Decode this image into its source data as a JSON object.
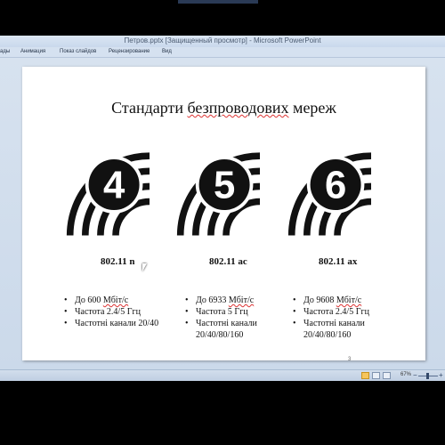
{
  "window": {
    "title": "Петров.pptx [Защищенный просмотр] - Microsoft PowerPoint"
  },
  "ribbon": {
    "tabs": [
      "ады",
      "Анимация",
      "Показ слайдов",
      "Рецензирование",
      "Вид"
    ]
  },
  "slide": {
    "title_pre": "Стандарти ",
    "title_underlined": "безпроводових",
    "title_post": " мереж",
    "number": "3",
    "columns": [
      {
        "icon_digit": "4",
        "icon_name": "wifi-4-icon",
        "standard": "802.11 n",
        "specs": [
          {
            "pre": "До 600 ",
            "u": "Мбіт/с",
            "post": ""
          },
          {
            "pre": "Частота 2.4/5 Ггц",
            "u": "",
            "post": ""
          },
          {
            "pre": "Частотні канали 20/40",
            "u": "",
            "post": ""
          }
        ]
      },
      {
        "icon_digit": "5",
        "icon_name": "wifi-5-icon",
        "standard": "802.11 ac",
        "specs": [
          {
            "pre": "До 6933 ",
            "u": "Мбіт/с",
            "post": ""
          },
          {
            "pre": "Частота  5 Ггц",
            "u": "",
            "post": ""
          },
          {
            "pre": "Частотні канали 20/40/80/160",
            "u": "",
            "post": ""
          }
        ]
      },
      {
        "icon_digit": "6",
        "icon_name": "wifi-6-icon",
        "standard": "802.11 ax",
        "specs": [
          {
            "pre": "До 9608 ",
            "u": "Мбіт/с",
            "post": ""
          },
          {
            "pre": "Частота 2.4/5 Ггц",
            "u": "",
            "post": ""
          },
          {
            "pre": "Частотні канали 20/40/80/160",
            "u": "",
            "post": ""
          }
        ]
      }
    ]
  },
  "statusbar": {
    "zoom": "67%",
    "zoom_minus": "−",
    "zoom_plus": "+"
  }
}
